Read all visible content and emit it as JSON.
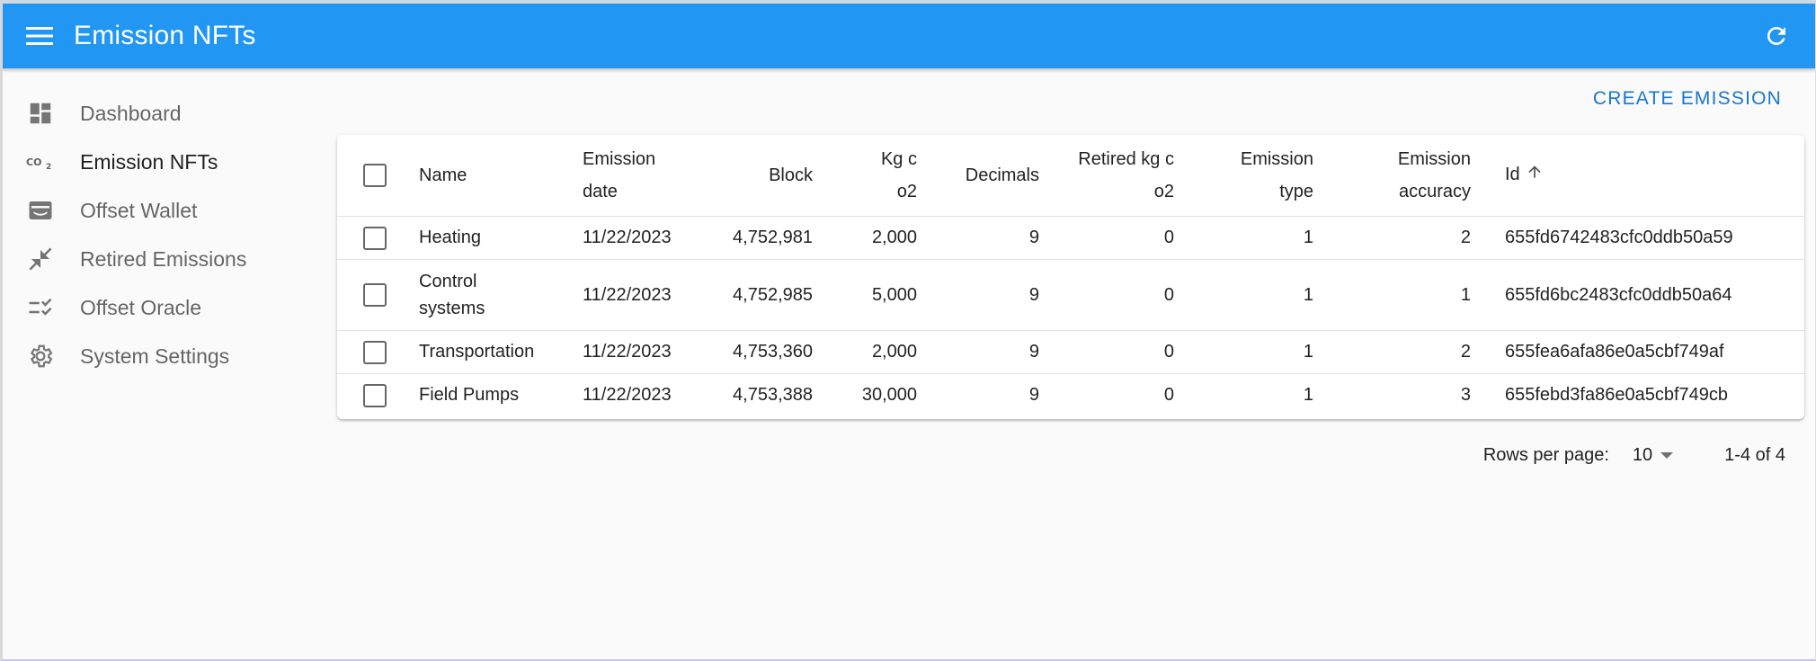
{
  "app": {
    "title": "Emission NFTs",
    "accent_color": "#2196f3",
    "icons": {
      "menu": "hamburger-menu-icon",
      "refresh": "refresh-icon"
    }
  },
  "sidebar": {
    "items": [
      {
        "label": "Dashboard",
        "icon": "dashboard-icon"
      },
      {
        "label": "Emission NFTs",
        "icon": "co2-icon",
        "active": true
      },
      {
        "label": "Offset Wallet",
        "icon": "wallet-icon"
      },
      {
        "label": "Retired Emissions",
        "icon": "collapse-arrows-icon"
      },
      {
        "label": "Offset Oracle",
        "icon": "checklist-icon"
      },
      {
        "label": "System Settings",
        "icon": "gear-icon"
      }
    ]
  },
  "toolbar": {
    "create_label": "CREATE EMISSION"
  },
  "table": {
    "columns": {
      "name": "Name",
      "emission_date": "Emission date",
      "block": "Block",
      "kg_co2": "Kg c o2",
      "decimals": "Decimals",
      "retired": "Retired kg c o2",
      "emission_type": "Emission type",
      "emission_accuracy": "Emission accuracy",
      "id": "Id"
    },
    "sorted_by": "id-ascending",
    "rows": [
      {
        "name": "Heating",
        "emission_date": "11/22/2023",
        "block": "4,752,981",
        "kg_co2": "2,000",
        "decimals": "9",
        "retired": "0",
        "emission_type": "1",
        "emission_accuracy": "2",
        "id": "655fd6742483cfc0ddb50a59"
      },
      {
        "name": "Control systems",
        "emission_date": "11/22/2023",
        "block": "4,752,985",
        "kg_co2": "5,000",
        "decimals": "9",
        "retired": "0",
        "emission_type": "1",
        "emission_accuracy": "1",
        "id": "655fd6bc2483cfc0ddb50a64"
      },
      {
        "name": "Transportation",
        "emission_date": "11/22/2023",
        "block": "4,753,360",
        "kg_co2": "2,000",
        "decimals": "9",
        "retired": "0",
        "emission_type": "1",
        "emission_accuracy": "2",
        "id": "655fea6afa86e0a5cbf749af"
      },
      {
        "name": "Field Pumps",
        "emission_date": "11/22/2023",
        "block": "4,753,388",
        "kg_co2": "30,000",
        "decimals": "9",
        "retired": "0",
        "emission_type": "1",
        "emission_accuracy": "3",
        "id": "655febd3fa86e0a5cbf749cb"
      }
    ]
  },
  "pagination": {
    "rows_per_page_label": "Rows per page:",
    "rows_per_page": "10",
    "range": "1-4 of 4"
  }
}
